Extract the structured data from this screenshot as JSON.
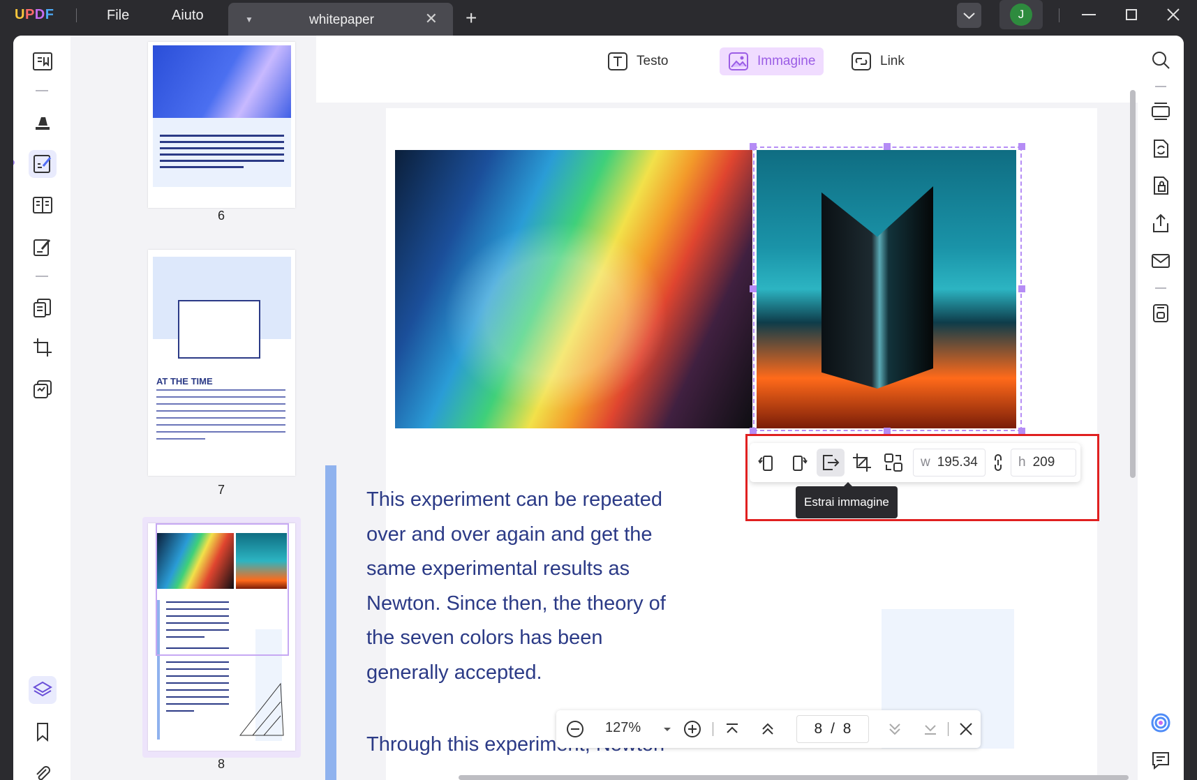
{
  "app": {
    "logo_parts": [
      "U",
      "P",
      "D",
      "F"
    ],
    "menu": {
      "file": "File",
      "help": "Aiuto"
    },
    "tab": {
      "title": "whitepaper"
    },
    "user_initial": "J"
  },
  "thumbnails": {
    "pages": [
      {
        "number": "6"
      },
      {
        "number": "7",
        "heading": "AT THE TIME"
      },
      {
        "number": "8"
      }
    ]
  },
  "edit_toolbar": {
    "text": "Testo",
    "image": "Immagine",
    "link": "Link",
    "active": "image"
  },
  "document": {
    "paragraph1": "This experiment can be repeated over and over again and get the same experimental results as Newton. Since then, the theory of the seven colors has been generally accepted.",
    "paragraph2": "Through this experiment, Newton"
  },
  "image_tools": {
    "width_label": "w",
    "width_value": "195.34",
    "height_label": "h",
    "height_value": "209",
    "tooltip": "Estrai immagine"
  },
  "nav": {
    "zoom": "127%",
    "current_page": "8",
    "separator": "/",
    "total_pages": "8"
  },
  "colors": {
    "accent": "#9b5de5",
    "selection": "#b58cf5",
    "highlight_outline": "#e02020",
    "body_text": "#2b3a86"
  }
}
